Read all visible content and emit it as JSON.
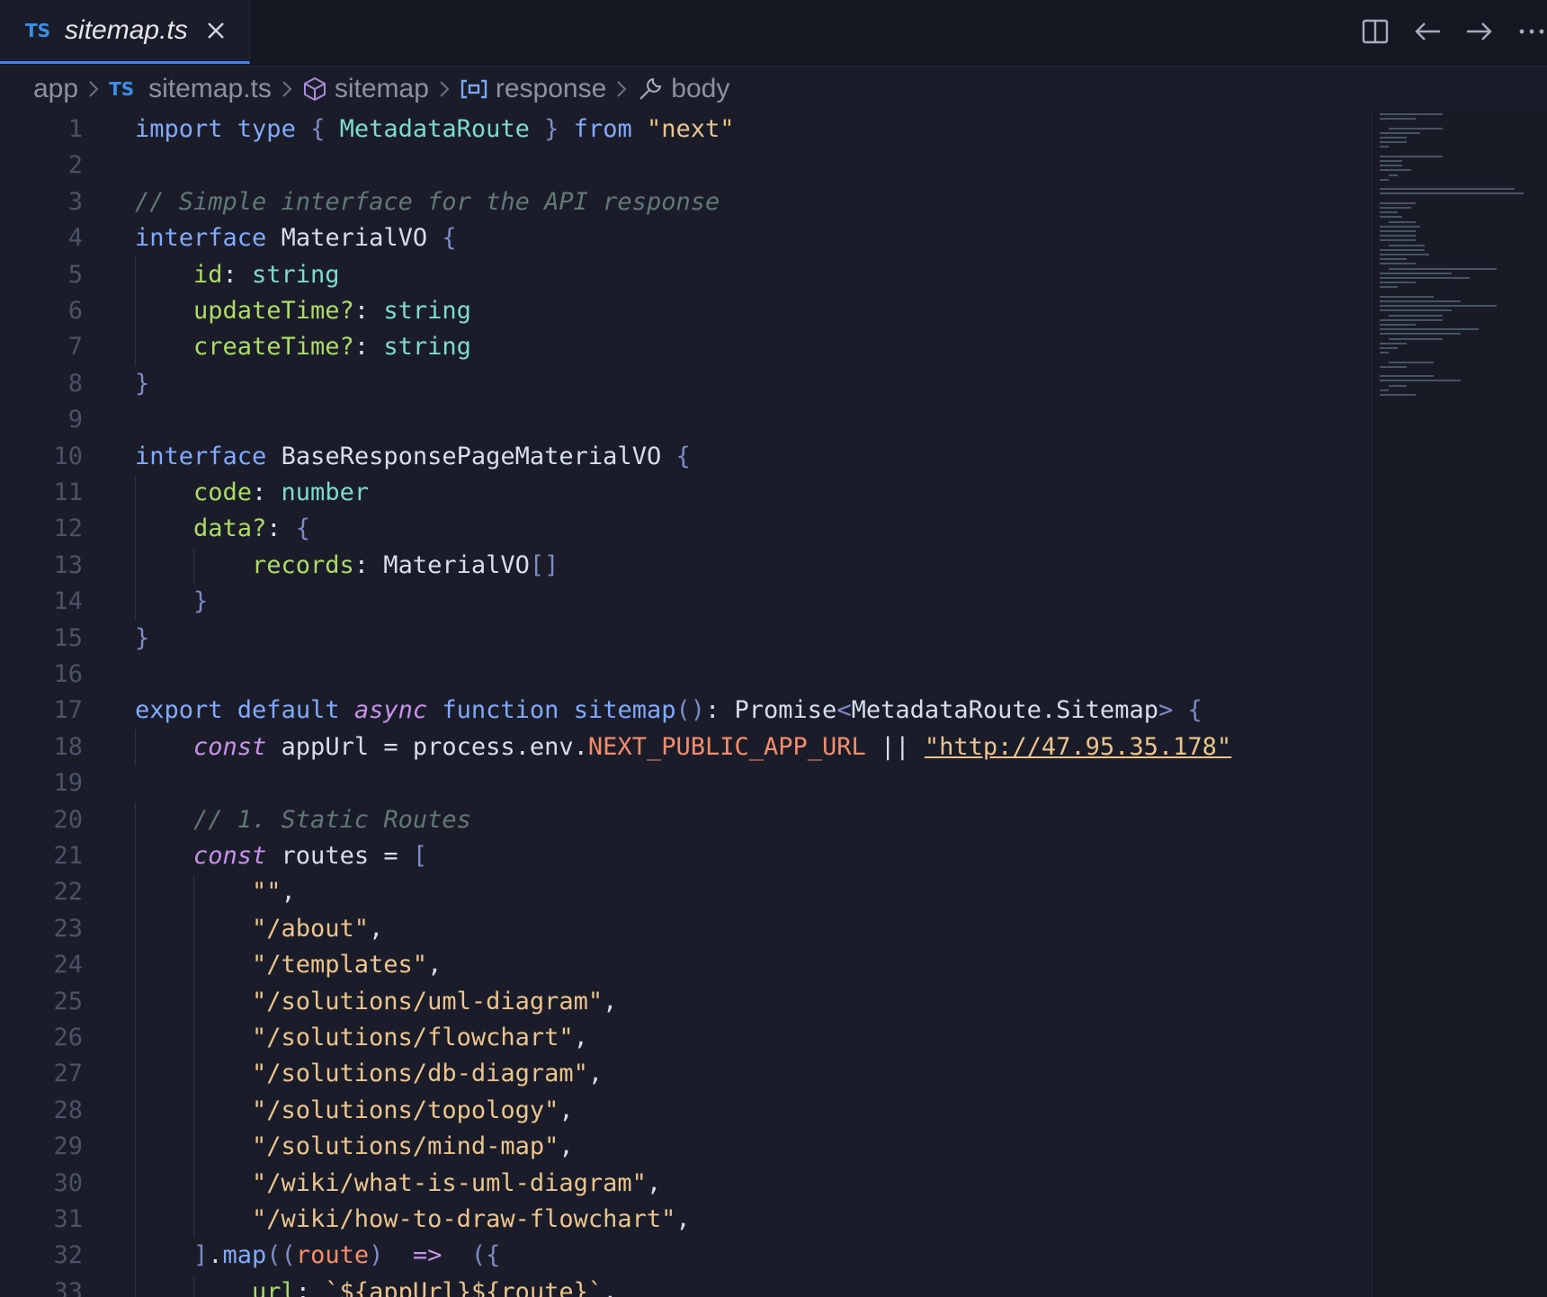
{
  "tab": {
    "badge": "TS",
    "title": "sitemap.ts"
  },
  "toolbar_icons": [
    "split-editor-icon",
    "arrow-left-icon",
    "arrow-right-icon",
    "more-icon"
  ],
  "breadcrumb": [
    {
      "label": "app",
      "icon": ""
    },
    {
      "label": "sitemap.ts",
      "icon": "ts-file-icon",
      "badge": "TS"
    },
    {
      "label": "sitemap",
      "icon": "cube-icon"
    },
    {
      "label": "response",
      "icon": "variable-icon"
    },
    {
      "label": "body",
      "icon": "wrench-icon"
    }
  ],
  "lines": [
    {
      "n": "1",
      "tokens": [
        [
          "kw2",
          "import "
        ],
        [
          "kw2",
          "type "
        ],
        [
          "punc",
          "{ "
        ],
        [
          "type",
          "MetadataRoute"
        ],
        [
          "punc",
          " } "
        ],
        [
          "kw2",
          "from "
        ],
        [
          "str",
          "\"next\""
        ]
      ]
    },
    {
      "n": "2",
      "tokens": []
    },
    {
      "n": "3",
      "tokens": [
        [
          "com",
          "// Simple interface for the API response"
        ]
      ]
    },
    {
      "n": "4",
      "tokens": [
        [
          "kw2",
          "interface "
        ],
        [
          "id",
          "MaterialVO "
        ],
        [
          "punc",
          "{"
        ]
      ]
    },
    {
      "n": "5",
      "indent": 1,
      "tokens": [
        [
          "prop",
          "id"
        ],
        [
          "id",
          ": "
        ],
        [
          "type",
          "string"
        ]
      ]
    },
    {
      "n": "6",
      "indent": 1,
      "tokens": [
        [
          "prop",
          "updateTime?"
        ],
        [
          "id",
          ": "
        ],
        [
          "type",
          "string"
        ]
      ]
    },
    {
      "n": "7",
      "indent": 1,
      "tokens": [
        [
          "prop",
          "createTime?"
        ],
        [
          "id",
          ": "
        ],
        [
          "type",
          "string"
        ]
      ]
    },
    {
      "n": "8",
      "tokens": [
        [
          "punc",
          "}"
        ]
      ]
    },
    {
      "n": "9",
      "tokens": []
    },
    {
      "n": "10",
      "tokens": [
        [
          "kw2",
          "interface "
        ],
        [
          "id",
          "BaseResponsePageMaterialVO "
        ],
        [
          "punc",
          "{"
        ]
      ]
    },
    {
      "n": "11",
      "indent": 1,
      "tokens": [
        [
          "prop",
          "code"
        ],
        [
          "id",
          ": "
        ],
        [
          "type",
          "number"
        ]
      ]
    },
    {
      "n": "12",
      "indent": 1,
      "tokens": [
        [
          "prop",
          "data?"
        ],
        [
          "id",
          ": "
        ],
        [
          "punc",
          "{"
        ]
      ]
    },
    {
      "n": "13",
      "indent": 2,
      "tokens": [
        [
          "prop",
          "records"
        ],
        [
          "id",
          ": MaterialVO"
        ],
        [
          "punc",
          "[]"
        ]
      ]
    },
    {
      "n": "14",
      "indent": 1,
      "tokens": [
        [
          "punc",
          "}"
        ]
      ]
    },
    {
      "n": "15",
      "tokens": [
        [
          "punc",
          "}"
        ]
      ]
    },
    {
      "n": "16",
      "tokens": []
    },
    {
      "n": "17",
      "tokens": [
        [
          "kw2",
          "export "
        ],
        [
          "kw2",
          "default "
        ],
        [
          "it",
          "async "
        ],
        [
          "kw2",
          "function "
        ],
        [
          "fn",
          "sitemap"
        ],
        [
          "punc",
          "()"
        ],
        [
          "id",
          ": Promise"
        ],
        [
          "punc",
          "<"
        ],
        [
          "id",
          "MetadataRoute.Sitemap"
        ],
        [
          "punc",
          "> {"
        ]
      ]
    },
    {
      "n": "18",
      "indent": 1,
      "tokens": [
        [
          "it",
          "const "
        ],
        [
          "id",
          "appUrl = process.env."
        ],
        [
          "const",
          "NEXT_PUBLIC_APP_URL"
        ],
        [
          "id",
          " || "
        ],
        [
          "str",
          "\"http://47.95.35.178\""
        ]
      ]
    },
    {
      "n": "19",
      "tokens": []
    },
    {
      "n": "20",
      "indent": 1,
      "tokens": [
        [
          "com",
          "// 1. Static Routes"
        ]
      ]
    },
    {
      "n": "21",
      "indent": 1,
      "tokens": [
        [
          "it",
          "const "
        ],
        [
          "id",
          "routes = "
        ],
        [
          "punc",
          "["
        ]
      ]
    },
    {
      "n": "22",
      "indent": 2,
      "tokens": [
        [
          "str",
          "\"\""
        ],
        [
          "id",
          ","
        ]
      ]
    },
    {
      "n": "23",
      "indent": 2,
      "tokens": [
        [
          "str",
          "\"/about\""
        ],
        [
          "id",
          ","
        ]
      ]
    },
    {
      "n": "24",
      "indent": 2,
      "tokens": [
        [
          "str",
          "\"/templates\""
        ],
        [
          "id",
          ","
        ]
      ]
    },
    {
      "n": "25",
      "indent": 2,
      "tokens": [
        [
          "str",
          "\"/solutions/uml-diagram\""
        ],
        [
          "id",
          ","
        ]
      ]
    },
    {
      "n": "26",
      "indent": 2,
      "tokens": [
        [
          "str",
          "\"/solutions/flowchart\""
        ],
        [
          "id",
          ","
        ]
      ]
    },
    {
      "n": "27",
      "indent": 2,
      "tokens": [
        [
          "str",
          "\"/solutions/db-diagram\""
        ],
        [
          "id",
          ","
        ]
      ]
    },
    {
      "n": "28",
      "indent": 2,
      "tokens": [
        [
          "str",
          "\"/solutions/topology\""
        ],
        [
          "id",
          ","
        ]
      ]
    },
    {
      "n": "29",
      "indent": 2,
      "tokens": [
        [
          "str",
          "\"/solutions/mind-map\""
        ],
        [
          "id",
          ","
        ]
      ]
    },
    {
      "n": "30",
      "indent": 2,
      "tokens": [
        [
          "str",
          "\"/wiki/what-is-uml-diagram\""
        ],
        [
          "id",
          ","
        ]
      ]
    },
    {
      "n": "31",
      "indent": 2,
      "tokens": [
        [
          "str",
          "\"/wiki/how-to-draw-flowchart\""
        ],
        [
          "id",
          ","
        ]
      ]
    },
    {
      "n": "32",
      "indent": 1,
      "tokens": [
        [
          "punc",
          "]"
        ],
        [
          "id",
          "."
        ],
        [
          "fn",
          "map"
        ],
        [
          "punc",
          "(("
        ],
        [
          "const",
          "route"
        ],
        [
          "punc",
          ")"
        ],
        [
          "kw",
          "  =>  "
        ],
        [
          "punc",
          "({"
        ]
      ]
    },
    {
      "n": "33",
      "indent": 2,
      "tokens": [
        [
          "prop",
          "url"
        ],
        [
          "id",
          ": "
        ],
        [
          "str",
          "`${appUrl}${route}`"
        ],
        [
          "id",
          ","
        ]
      ]
    }
  ],
  "colors": {
    "background": "#1a1d29",
    "accent": "#3b82f6",
    "keyword": "#82aaff",
    "type": "#7fdbca",
    "string": "#ecc48d",
    "comment": "#637777",
    "constant": "#f78c6c"
  }
}
